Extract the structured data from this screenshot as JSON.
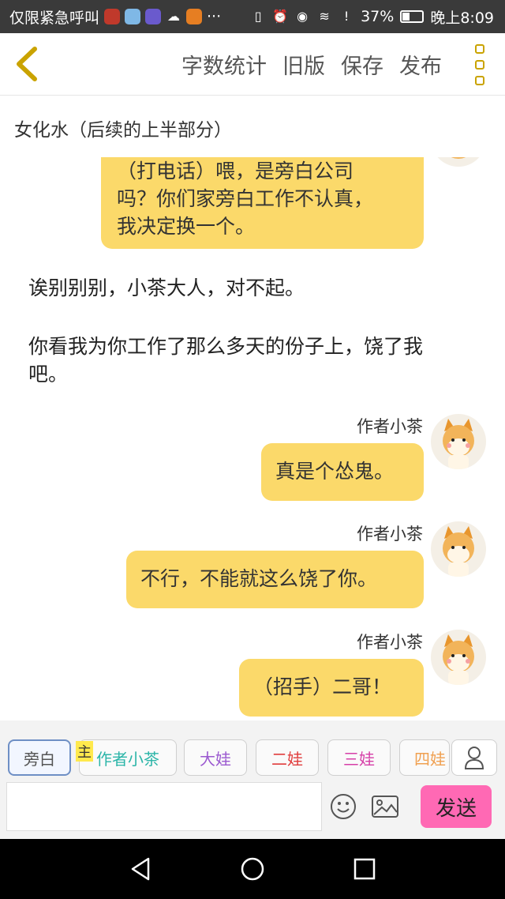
{
  "status_bar": {
    "carrier_text": "仅限紧急呼叫",
    "more": "···",
    "battery": "37%",
    "battery_level": 0.37,
    "time": "晚上8:09"
  },
  "toolbar": {
    "word_count": "字数统计",
    "old_version": "旧版",
    "save": "保存",
    "publish": "发布"
  },
  "title": "女化水（后续的上半部分）",
  "messages": [
    {
      "type": "bubble-cut",
      "text_lines": [
        "（打电话）喂，是旁白公司",
        "吗？你们家旁白工作不认真，",
        "我决定换一个。"
      ]
    },
    {
      "type": "narration",
      "text": "诶别别别，小茶大人，对不起。"
    },
    {
      "type": "narration",
      "text_lines": [
        "你看我为你工作了那么多天的份子上，饶了我",
        "吧。"
      ]
    },
    {
      "type": "author",
      "author": "作者小茶",
      "text": "真是个怂鬼。"
    },
    {
      "type": "author",
      "author": "作者小茶",
      "text": "不行，不能就这么饶了你。"
    },
    {
      "type": "author",
      "author": "作者小茶",
      "text": "（招手）二哥！"
    }
  ],
  "characters": {
    "host_badge": "主",
    "items": [
      {
        "label": "旁白",
        "color": "#555555",
        "active": true
      },
      {
        "label": "作者小茶",
        "color": "#2bb5a8",
        "active": false
      },
      {
        "label": "大娃",
        "color": "#9b59d0",
        "active": false
      },
      {
        "label": "二娃",
        "color": "#e03c3c",
        "active": false
      },
      {
        "label": "三娃",
        "color": "#d63fa8",
        "active": false
      },
      {
        "label": "四娃",
        "color": "#f0a050",
        "active": false
      }
    ]
  },
  "input": {
    "placeholder": ""
  },
  "send_label": "发送",
  "colors": {
    "bubble": "#fbd96a",
    "accent": "#caa300",
    "send": "#ff69b4"
  }
}
